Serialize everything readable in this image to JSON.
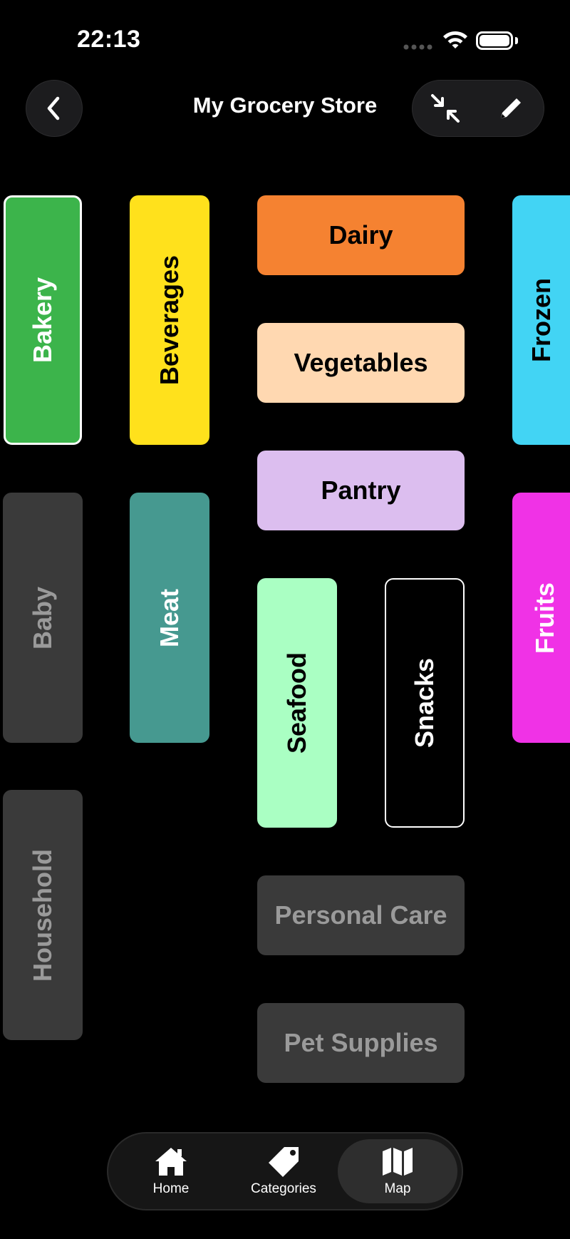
{
  "status_bar": {
    "time": "22:13"
  },
  "header": {
    "title": "My Grocery Store"
  },
  "aisles": {
    "bakery": "Bakery",
    "beverages": "Beverages",
    "dairy": "Dairy",
    "frozen": "Frozen",
    "vegetables": "Vegetables",
    "pantry": "Pantry",
    "baby": "Baby",
    "meat": "Meat",
    "seafood": "Seafood",
    "snacks": "Snacks",
    "fruits": "Fruits",
    "household": "Household",
    "personal_care": "Personal Care",
    "pet_supplies": "Pet Supplies"
  },
  "colors": {
    "bakery": "#3cb44b",
    "beverages": "#ffe11c",
    "dairy": "#f58231",
    "frozen": "#42d4f4",
    "vegetables": "#ffd8b1",
    "pantry": "#dcbeef",
    "meat": "#469990",
    "seafood": "#aaffc3",
    "fruits": "#f032e6",
    "inactive": "#3a3a3a"
  },
  "tabbar": {
    "home": "Home",
    "categories": "Categories",
    "map": "Map",
    "active": "Map"
  },
  "icons": [
    "chevron-left-icon",
    "collapse-arrows-icon",
    "pencil-icon",
    "house-icon",
    "tag-icon",
    "map-icon",
    "wifi-icon",
    "battery-icon"
  ]
}
